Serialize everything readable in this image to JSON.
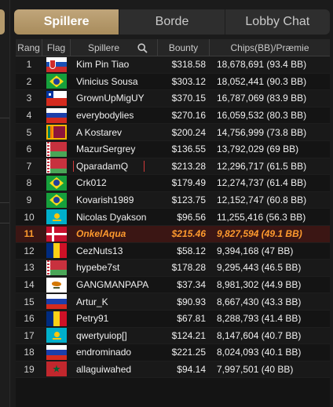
{
  "tabs": [
    {
      "label": "Spillere",
      "active": true
    },
    {
      "label": "Borde",
      "active": false
    },
    {
      "label": "Lobby Chat",
      "active": false
    }
  ],
  "headers": {
    "rank": "Rang",
    "flag": "Flag",
    "players": "Spillere",
    "bounty": "Bounty",
    "chips": "Chips(BB)/Præmie"
  },
  "colors": {
    "accent": "#b49a6c",
    "highlight_text": "#ff9a2e",
    "highlight_bg": "#3b1614"
  },
  "rows": [
    {
      "rank": "1",
      "flag": "sk",
      "name": "Kim Pin Tiao",
      "bounty": "$318.58",
      "chips": "18,678,691 (93.4 BB)"
    },
    {
      "rank": "2",
      "flag": "br",
      "name": "Vinicius Sousa",
      "bounty": "$303.12",
      "chips": "18,052,441 (90.3 BB)"
    },
    {
      "rank": "3",
      "flag": "cl",
      "name": "GrownUpMigUY",
      "bounty": "$370.15",
      "chips": "16,787,069 (83.9 BB)"
    },
    {
      "rank": "4",
      "flag": "ru",
      "name": "everybodylies",
      "bounty": "$270.16",
      "chips": "16,059,532 (80.3 BB)"
    },
    {
      "rank": "5",
      "flag": "lk",
      "name": "A Kostarev",
      "bounty": "$200.24",
      "chips": "14,756,999 (73.8 BB)"
    },
    {
      "rank": "6",
      "flag": "by",
      "name": "MazurSergrey",
      "bounty": "$136.55",
      "chips": "13,792,029 (69 BB)"
    },
    {
      "rank": "7",
      "flag": "by",
      "name": "QparadamQ",
      "bounty": "$213.28",
      "chips": "12,296,717 (61.5 BB)",
      "boxed": true
    },
    {
      "rank": "8",
      "flag": "br",
      "name": "Crk012",
      "bounty": "$179.49",
      "chips": "12,274,737 (61.4 BB)"
    },
    {
      "rank": "9",
      "flag": "br",
      "name": "Kovarish1989",
      "bounty": "$123.75",
      "chips": "12,152,747 (60.8 BB)"
    },
    {
      "rank": "10",
      "flag": "kz",
      "name": "Nicolas Dyakson",
      "bounty": "$96.56",
      "chips": "11,255,416 (56.3 BB)"
    },
    {
      "rank": "11",
      "flag": "dk",
      "name": "OnkelAqua",
      "bounty": "$215.46",
      "chips": "9,827,594 (49.1 BB)",
      "highlight": true
    },
    {
      "rank": "12",
      "flag": "ro",
      "name": "CezNuts13",
      "bounty": "$58.12",
      "chips": "9,394,168 (47 BB)"
    },
    {
      "rank": "13",
      "flag": "by",
      "name": "hypebe7st",
      "bounty": "$178.28",
      "chips": "9,295,443 (46.5 BB)"
    },
    {
      "rank": "14",
      "flag": "cy",
      "name": "GANGMANPAPA",
      "bounty": "$37.34",
      "chips": "8,981,302 (44.9 BB)"
    },
    {
      "rank": "15",
      "flag": "ru",
      "name": "Artur_K",
      "bounty": "$90.93",
      "chips": "8,667,430 (43.3 BB)"
    },
    {
      "rank": "16",
      "flag": "ro",
      "name": "Petry91",
      "bounty": "$67.81",
      "chips": "8,288,793 (41.4 BB)"
    },
    {
      "rank": "17",
      "flag": "kz",
      "name": "qwertyuiop[]",
      "bounty": "$124.21",
      "chips": "8,147,604 (40.7 BB)"
    },
    {
      "rank": "18",
      "flag": "ru",
      "name": "endrominado",
      "bounty": "$221.25",
      "chips": "8,024,093 (40.1 BB)"
    },
    {
      "rank": "19",
      "flag": "ma",
      "name": "allaguiwahed",
      "bounty": "$94.14",
      "chips": "7,997,501 (40 BB)"
    }
  ]
}
